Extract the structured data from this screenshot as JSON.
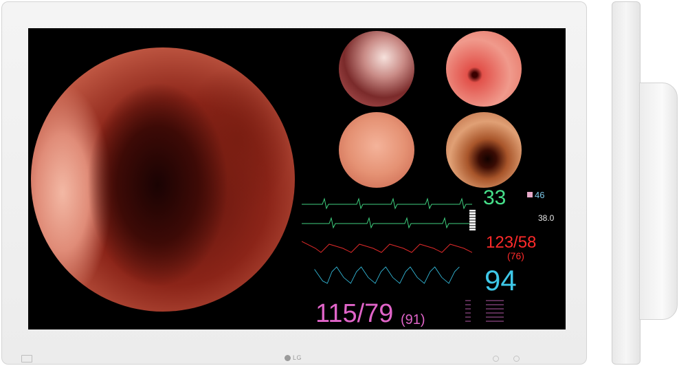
{
  "brand": "LG",
  "vitals": {
    "ecg_hr": "33",
    "temp1": "46",
    "temp2": "38.0",
    "abp": "123/58",
    "abp_mean": "(76)",
    "spo2": "94",
    "nibp": "115/79",
    "nibp_mean": "(91)"
  },
  "colors": {
    "ecg": "#46e08a",
    "temp": "#7cc8e8",
    "abp": "#ff2a2a",
    "spo2": "#3ec8e8",
    "nibp": "#e064c8"
  },
  "icons": {
    "logo": "lg-logo-icon",
    "input": "input-button-icon",
    "menu": "menu-button-icon",
    "power": "power-button-icon"
  }
}
